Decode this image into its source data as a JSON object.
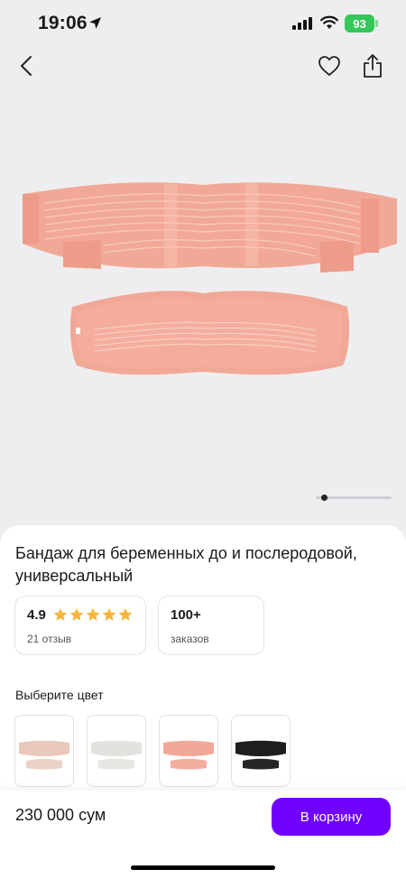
{
  "status_bar": {
    "time": "19:06",
    "battery": "93"
  },
  "nav": {
    "back_icon": "chevron-left-icon",
    "favorite_icon": "heart-icon",
    "share_icon": "share-icon"
  },
  "product": {
    "title": "Бандаж для беременных до и послеродовой, универсальный",
    "rating": "4.9",
    "stars": 5,
    "reviews": "21 отзыв",
    "orders_count": "100+",
    "orders_label": "заказов",
    "image_index": 1,
    "image_count": 8
  },
  "color_picker": {
    "label": "Выберите цвет",
    "options": [
      {
        "name": "beige",
        "color": "#e8c9bb"
      },
      {
        "name": "white",
        "color": "#ececea"
      },
      {
        "name": "pink",
        "color": "#f2a896"
      },
      {
        "name": "black",
        "color": "#1e1e1e"
      }
    ]
  },
  "bottom_bar": {
    "price": "230 000 сум",
    "cart_label": "В корзину"
  },
  "colors": {
    "accent": "#7000ff",
    "star": "#f6b53b",
    "battery": "#35c759"
  }
}
